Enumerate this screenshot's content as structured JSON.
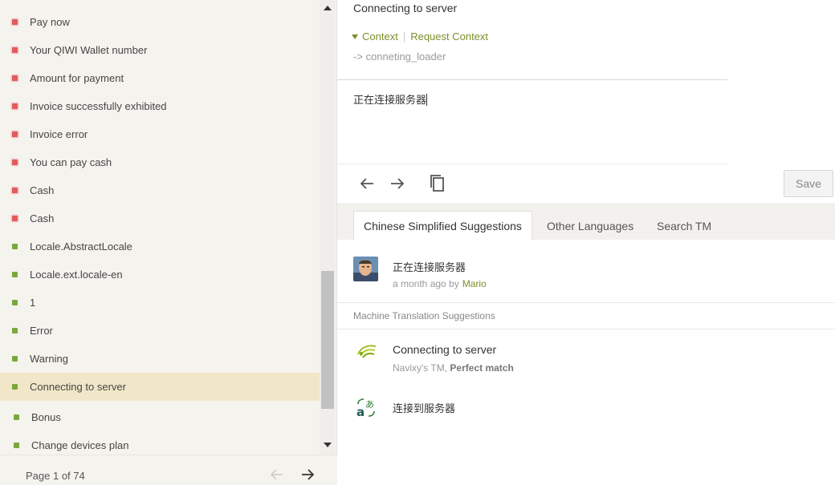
{
  "strings_list": {
    "items": [
      {
        "label": "Pay now",
        "status": "untranslated"
      },
      {
        "label": "Your QIWI Wallet number",
        "status": "untranslated"
      },
      {
        "label": "Amount for payment",
        "status": "untranslated"
      },
      {
        "label": "Invoice successfully exhibited",
        "status": "untranslated"
      },
      {
        "label": "Invoice error",
        "status": "untranslated"
      },
      {
        "label": "You can pay cash",
        "status": "untranslated"
      },
      {
        "label": "Cash",
        "status": "untranslated"
      },
      {
        "label": "Cash",
        "status": "untranslated"
      },
      {
        "label": "Locale.AbstractLocale",
        "status": "translated"
      },
      {
        "label": "Locale.ext.locale-en",
        "status": "translated"
      },
      {
        "label": "1",
        "status": "translated"
      },
      {
        "label": "Error",
        "status": "translated"
      },
      {
        "label": "Warning",
        "status": "translated"
      },
      {
        "label": "Connecting to server",
        "status": "translated",
        "active": true
      },
      {
        "label": "Bonus",
        "status": "translated"
      },
      {
        "label": "Change devices plan",
        "status": "translated"
      }
    ],
    "colors": {
      "untranslated": "#e25b5b",
      "translated": "#7aa83b",
      "active_bg": "#f1e7c8"
    }
  },
  "pager": {
    "text": "Page 1 of 74",
    "prev_icon": "arrow-left-icon",
    "next_icon": "arrow-right-icon"
  },
  "editor": {
    "source_text": "Connecting to server",
    "context_label": "Context",
    "request_context_label": "Request Context",
    "context_value": "-> conneting_loader",
    "translation_text": "正在连接服务器",
    "toolbar": {
      "back_icon": "arrow-left-icon",
      "forward_icon": "arrow-right-icon",
      "copy_icon": "copy-icon"
    },
    "save_label": "Save"
  },
  "tabs": [
    {
      "label": "Chinese Simplified Suggestions",
      "active": true
    },
    {
      "label": "Other Languages",
      "active": false
    },
    {
      "label": "Search TM",
      "active": false
    }
  ],
  "suggestion": {
    "text": "正在连接服务器",
    "time": "a month ago by",
    "user": "Mario"
  },
  "machine_translation": {
    "header": "Machine Translation Suggestions",
    "items": [
      {
        "text": "Connecting to server",
        "source": "Navixy's TM,",
        "match": "Perfect match",
        "icon": "navixy-tm-icon"
      },
      {
        "text": "连接到服务器",
        "icon": "google-translate-icon"
      }
    ]
  },
  "accent_color": "#7a8f2a"
}
